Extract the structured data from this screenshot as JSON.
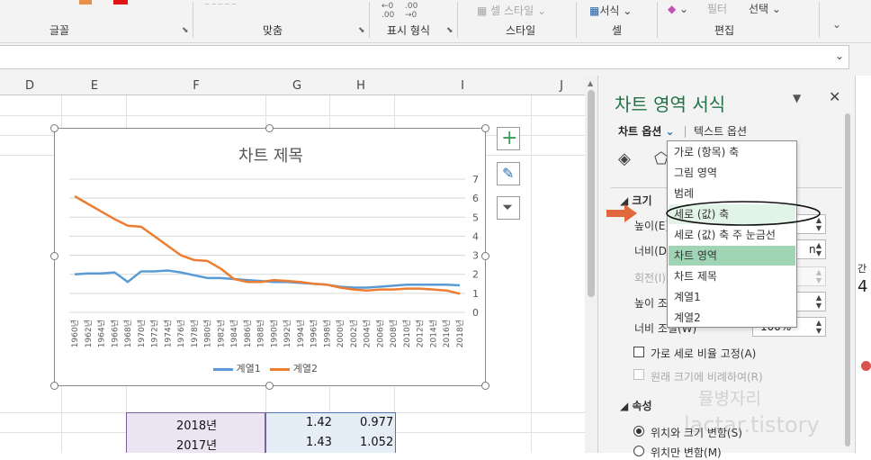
{
  "ribbon": {
    "groups": [
      "글꼴",
      "맞춤",
      "표시 형식",
      "스타일",
      "셀",
      "편집"
    ],
    "cell_style_label": "셀 스타일",
    "format_label": "서식",
    "fill_label": "필터",
    "select_label": "선택"
  },
  "columns": [
    "D",
    "E",
    "F",
    "G",
    "H",
    "I",
    "J"
  ],
  "chart": {
    "title": "차트 제목",
    "legend": [
      "계열1",
      "계열2"
    ]
  },
  "chart_data": {
    "type": "line",
    "title": "차트 제목",
    "ylim": [
      0,
      7
    ],
    "y_ticks": [
      "0",
      "1",
      "2",
      "3",
      "4",
      "5",
      "6",
      "7"
    ],
    "y_axis_side": "right",
    "x": [
      "1960년",
      "1962년",
      "1964년",
      "1966년",
      "1968년",
      "1970년",
      "1972년",
      "1974년",
      "1976년",
      "1978년",
      "1980년",
      "1982년",
      "1984년",
      "1986년",
      "1988년",
      "1990년",
      "1992년",
      "1994년",
      "1996년",
      "1998년",
      "2000년",
      "2002년",
      "2004년",
      "2006년",
      "2008년",
      "2010년",
      "2012년",
      "2014년",
      "2016년",
      "2018년"
    ],
    "series": [
      {
        "name": "계열1",
        "color": "#5b9bd5",
        "values": [
          2.0,
          2.05,
          2.05,
          2.1,
          1.6,
          2.15,
          2.15,
          2.2,
          2.1,
          1.95,
          1.8,
          1.8,
          1.75,
          1.7,
          1.65,
          1.6,
          1.6,
          1.55,
          1.5,
          1.45,
          1.35,
          1.3,
          1.3,
          1.35,
          1.4,
          1.45,
          1.45,
          1.45,
          1.45,
          1.42
        ]
      },
      {
        "name": "계열2",
        "color": "#ed7d31",
        "values": [
          6.1,
          5.7,
          5.3,
          4.9,
          4.55,
          4.5,
          4.0,
          3.5,
          3.0,
          2.75,
          2.7,
          2.3,
          1.75,
          1.6,
          1.6,
          1.7,
          1.65,
          1.6,
          1.5,
          1.45,
          1.3,
          1.2,
          1.15,
          1.2,
          1.2,
          1.25,
          1.25,
          1.2,
          1.15,
          0.977
        ]
      }
    ]
  },
  "cells": [
    {
      "year": "2018년",
      "v1": "1.42",
      "v2": "0.977"
    },
    {
      "year": "2017년",
      "v1": "1.43",
      "v2": "1.052"
    }
  ],
  "pane": {
    "title": "차트 영역 서식",
    "tab_chart": "차트 옵션",
    "tab_text": "텍스트 옵션",
    "size_header": "크기",
    "height_label": "높이(E)",
    "width_label": "너비(D)",
    "rotate_label": "회전(I)",
    "scale_h_label": "높이 조절(H)",
    "scale_w_label": "너비 조절(W)",
    "scale_w_value": "100%",
    "height_value_tail": "n",
    "width_value_tail": "n",
    "lock_ratio": "가로 세로 비율 고정(A)",
    "relative_original": "원래 크기에 비례하여(R)",
    "props_header": "속성",
    "radio1": "위치와 크기 변함(S)",
    "radio2": "위치만 변함(M)"
  },
  "dropdown": {
    "items": [
      "가로 (항목) 축",
      "그림 영역",
      "범례",
      "세로 (값) 축",
      "세로 (값) 축 주 눈금선",
      "차트 영역",
      "차트 제목",
      "계열1",
      "계열2"
    ],
    "selected_index": 5,
    "hover_index": 3
  },
  "watermark": "뮬병자리",
  "watermark2": "lactar.tistory",
  "right_partial": [
    "간",
    "4"
  ]
}
